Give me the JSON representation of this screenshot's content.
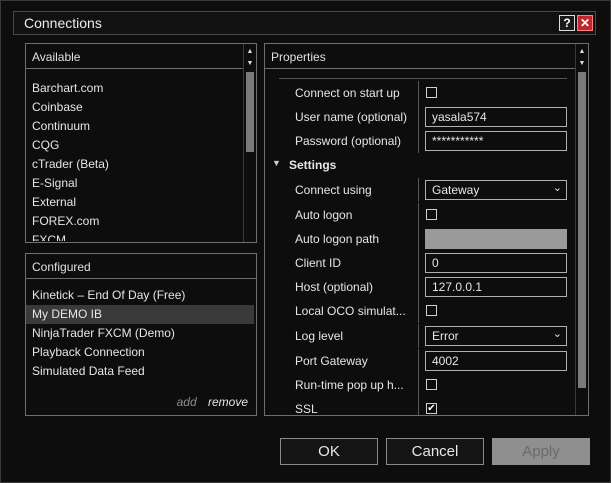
{
  "window": {
    "title": "Connections",
    "help": "?",
    "close": "✕"
  },
  "available": {
    "header": "Available",
    "items": [
      "Barchart.com",
      "Coinbase",
      "Continuum",
      "CQG",
      "cTrader (Beta)",
      "E-Signal",
      "External",
      "FOREX.com",
      "FXCM"
    ]
  },
  "configured": {
    "header": "Configured",
    "items": [
      "Kinetick – End Of Day (Free)",
      "My DEMO IB",
      "NinjaTrader FXCM (Demo)",
      "Playback Connection",
      "Simulated Data Feed"
    ],
    "selected_index": 1,
    "add": "add",
    "remove": "remove"
  },
  "properties": {
    "header": "Properties",
    "connect_on_start": {
      "label": "Connect on start up",
      "checked": false
    },
    "username": {
      "label": "User name (optional)",
      "value": "yasala574"
    },
    "password": {
      "label": "Password (optional)",
      "value": "***********"
    },
    "settings": {
      "label": "Settings"
    },
    "connect_using": {
      "label": "Connect using",
      "value": "Gateway"
    },
    "auto_logon": {
      "label": "Auto logon",
      "checked": false
    },
    "auto_logon_path": {
      "label": "Auto logon path",
      "value": ""
    },
    "client_id": {
      "label": "Client ID",
      "value": "0"
    },
    "host": {
      "label": "Host (optional)",
      "value": "127.0.0.1"
    },
    "local_oco": {
      "label": "Local OCO simulat...",
      "checked": false
    },
    "log_level": {
      "label": "Log level",
      "value": "Error"
    },
    "port_gateway": {
      "label": "Port Gateway",
      "value": "4002"
    },
    "runtime_popup": {
      "label": "Run-time pop up h...",
      "checked": false
    },
    "ssl": {
      "label": "SSL",
      "checked": true
    }
  },
  "buttons": {
    "ok": "OK",
    "cancel": "Cancel",
    "apply": "Apply"
  },
  "icons": {
    "checkmark": "✔",
    "dropdown": "⌄",
    "expanded": "▼"
  }
}
